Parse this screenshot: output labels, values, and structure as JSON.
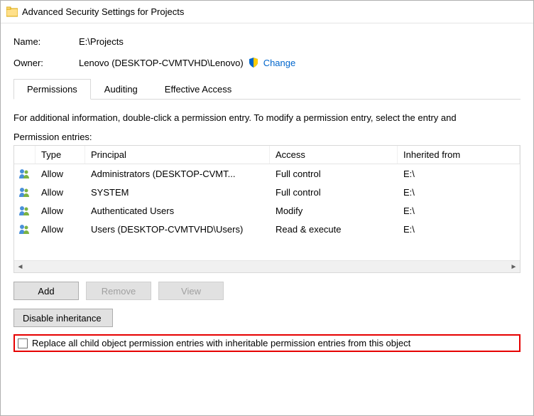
{
  "titlebar": {
    "title": "Advanced Security Settings for Projects"
  },
  "name": {
    "label": "Name:",
    "value": "E:\\Projects"
  },
  "owner": {
    "label": "Owner:",
    "value": "Lenovo (DESKTOP-CVMTVHD\\Lenovo)",
    "change": "Change"
  },
  "tabs": {
    "t0": "Permissions",
    "t1": "Auditing",
    "t2": "Effective Access"
  },
  "info": "For additional information, double-click a permission entry. To modify a permission entry, select the entry and",
  "entriesLabel": "Permission entries:",
  "headers": {
    "type": "Type",
    "principal": "Principal",
    "access": "Access",
    "inherited": "Inherited from"
  },
  "rows": [
    {
      "type": "Allow",
      "principal": "Administrators (DESKTOP-CVMT...",
      "access": "Full control",
      "inherited": "E:\\"
    },
    {
      "type": "Allow",
      "principal": "SYSTEM",
      "access": "Full control",
      "inherited": "E:\\"
    },
    {
      "type": "Allow",
      "principal": "Authenticated Users",
      "access": "Modify",
      "inherited": "E:\\"
    },
    {
      "type": "Allow",
      "principal": "Users (DESKTOP-CVMTVHD\\Users)",
      "access": "Read & execute",
      "inherited": "E:\\"
    }
  ],
  "buttons": {
    "add": "Add",
    "remove": "Remove",
    "view": "View",
    "disable": "Disable inheritance"
  },
  "replaceCheckbox": "Replace all child object permission entries with inheritable permission entries from this object"
}
